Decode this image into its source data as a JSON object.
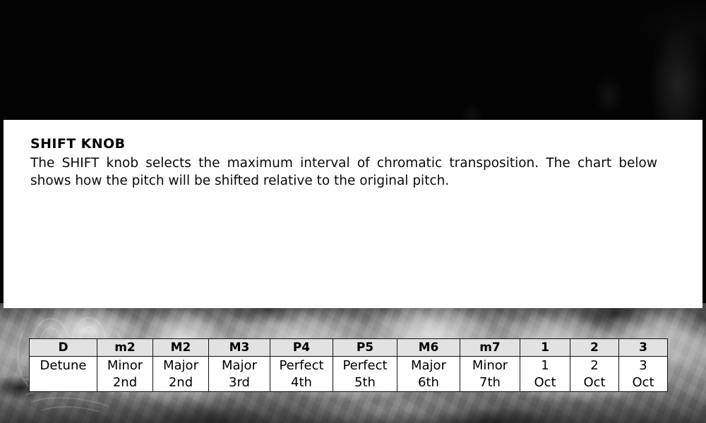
{
  "panel": {
    "heading": "SHIFT KNOB",
    "description": "The SHIFT knob selects the maximum interval of chromatic transposition. The chart below shows how the pitch will be shifted relative to the original pitch."
  },
  "chart_data": {
    "type": "table",
    "title": "SHIFT KNOB",
    "columns": [
      "D",
      "m2",
      "M2",
      "M3",
      "P4",
      "P5",
      "M6",
      "m7",
      "1",
      "2",
      "3"
    ],
    "rows": [
      {
        "line1": [
          "Detune",
          "Minor",
          "Major",
          "Major",
          "Perfect",
          "Perfect",
          "Major",
          "Minor",
          "1",
          "2",
          "3"
        ],
        "line2": [
          "",
          "2nd",
          "2nd",
          "3rd",
          "4th",
          "5th",
          "6th",
          "7th",
          "Oct",
          "Oct",
          "Oct"
        ]
      }
    ],
    "header_background": "#e2e2e2",
    "cell_background": "#ffffff",
    "border_color": "#111111",
    "column_widths": [
      "wide",
      "wide",
      "wide",
      "wide",
      "wide",
      "wide",
      "wide",
      "wide",
      "narrow",
      "narrow",
      "narrow"
    ]
  },
  "colors": {
    "panel_background": "#ffffff",
    "page_background": "#030303",
    "text": "#000000",
    "smoke_light": "#a8a8a8"
  }
}
